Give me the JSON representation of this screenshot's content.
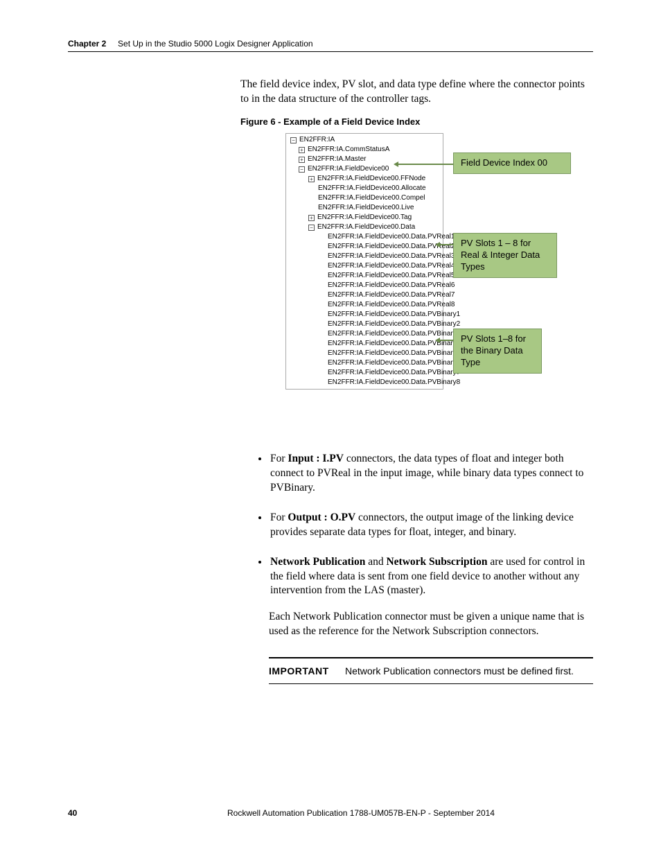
{
  "header": {
    "chapter": "Chapter 2",
    "title": "Set Up in the Studio 5000 Logix Designer Application"
  },
  "intro": "The field device index, PV slot, and data type define where the connector points to in the data structure of the controller tags.",
  "figure_caption": "Figure 6 - Example of a Field Device Index",
  "tree": {
    "root": "EN2FFR:IA",
    "n1": "EN2FFR:IA.CommStatusA",
    "n2": "EN2FFR:IA.Master",
    "n3": "EN2FFR:IA.FieldDevice00",
    "n3a": "EN2FFR:IA.FieldDevice00.FFNode",
    "n3b": "EN2FFR:IA.FieldDevice00.Allocate",
    "n3c": "EN2FFR:IA.FieldDevice00.Compel",
    "n3d": "EN2FFR:IA.FieldDevice00.Live",
    "n3e": "EN2FFR:IA.FieldDevice00.Tag",
    "n3f": "EN2FFR:IA.FieldDevice00.Data",
    "r1": "EN2FFR:IA.FieldDevice00.Data.PVReal1",
    "r2": "EN2FFR:IA.FieldDevice00.Data.PVReal2",
    "r3": "EN2FFR:IA.FieldDevice00.Data.PVReal3",
    "r4": "EN2FFR:IA.FieldDevice00.Data.PVReal4",
    "r5": "EN2FFR:IA.FieldDevice00.Data.PVReal5",
    "r6": "EN2FFR:IA.FieldDevice00.Data.PVReal6",
    "r7": "EN2FFR:IA.FieldDevice00.Data.PVReal7",
    "r8": "EN2FFR:IA.FieldDevice00.Data.PVReal8",
    "b1": "EN2FFR:IA.FieldDevice00.Data.PVBinary1",
    "b2": "EN2FFR:IA.FieldDevice00.Data.PVBinary2",
    "b3": "EN2FFR:IA.FieldDevice00.Data.PVBinary3",
    "b4": "EN2FFR:IA.FieldDevice00.Data.PVBinary4",
    "b5": "EN2FFR:IA.FieldDevice00.Data.PVBinary5",
    "b6": "EN2FFR:IA.FieldDevice00.Data.PVBinary6",
    "b7": "EN2FFR:IA.FieldDevice00.Data.PVBinary7",
    "b8": "EN2FFR:IA.FieldDevice00.Data.PVBinary8"
  },
  "callouts": {
    "c1": "Field Device Index 00",
    "c2": "PV Slots 1 – 8 for Real & Integer Data Types",
    "c3": "PV Slots 1–8 for the Binary Data Type"
  },
  "bullets": {
    "b1_pre": "For ",
    "b1_bold": "Input : I.PV",
    "b1_post": " connectors, the data types of float and integer both connect to PVReal in the input image, while binary data types connect to PVBinary.",
    "b2_pre": "For ",
    "b2_bold": "Output : O.PV",
    "b2_post": " connectors, the output image of the linking device provides separate data types for float, integer, and binary.",
    "b3_bold1": "Network Publication",
    "b3_mid": " and ",
    "b3_bold2": "Network Subscription",
    "b3_post": " are used for control in the field where data is sent from one field device to another without any intervention from the LAS (master)."
  },
  "para_after": "Each Network Publication connector must be given a unique name that is used as the reference for the Network Subscription connectors.",
  "important": {
    "label": "IMPORTANT",
    "text": "Network Publication connectors must be defined first."
  },
  "footer": {
    "page": "40",
    "pub": "Rockwell Automation Publication 1788-UM057B-EN-P - September 2014"
  }
}
